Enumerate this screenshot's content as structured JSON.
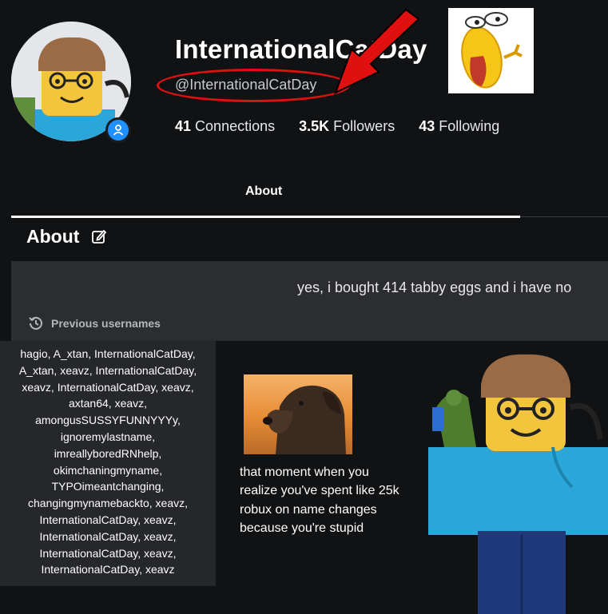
{
  "profile": {
    "display_name": "InternationalCatDay",
    "username": "@InternationalCatDay"
  },
  "stats": {
    "connections_count": "41",
    "connections_label": "Connections",
    "followers_count": "3.5K",
    "followers_label": "Followers",
    "following_count": "43",
    "following_label": "Following"
  },
  "tabs": {
    "about": "About"
  },
  "about": {
    "title": "About",
    "bio": "yes, i bought 414 tabby eggs and i have no",
    "previous_usernames_label": "Previous usernames",
    "previous_usernames_lines": [
      "hagio, A_xtan, InternationalCatDay,",
      "A_xtan, xeavz, InternationalCatDay,",
      "xeavz, InternationalCatDay, xeavz,",
      "axtan64, xeavz,",
      "amongusSUSSYFUNNYYYy,",
      "ignoremylastname,",
      "imreallyboredRNhelp,",
      "okimchaningmyname,",
      "TYPOimeantchanging,",
      "changingmynamebackto, xeavz,",
      "InternationalCatDay, xeavz,",
      "InternationalCatDay, xeavz,",
      "InternationalCatDay, xeavz,",
      "InternationalCatDay, xeavz"
    ]
  },
  "meme": {
    "caption_lines": [
      "that moment when you",
      "realize you've spent like 25k",
      "robux on name changes",
      "because you're stupid"
    ]
  },
  "icons": {
    "verified": "person-icon",
    "edit": "edit-icon",
    "history": "history-icon"
  },
  "colors": {
    "background": "#111214",
    "panel": "#2b2d31",
    "accent_blue": "#1e90ff",
    "annotation_red": "#e01010"
  }
}
